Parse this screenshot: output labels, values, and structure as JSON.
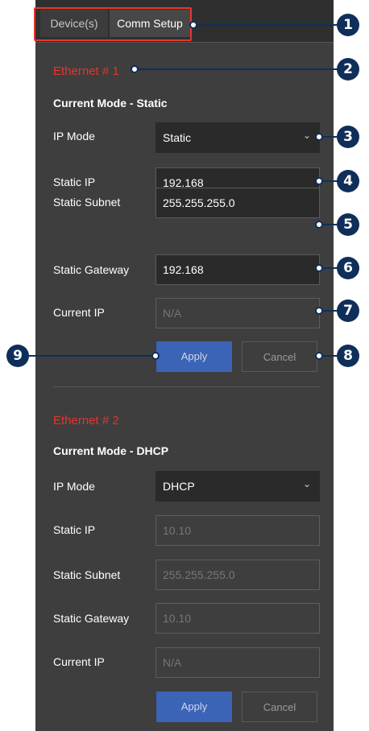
{
  "tabs": [
    {
      "label": "Device(s)"
    },
    {
      "label": "Comm Setup"
    }
  ],
  "ethernet1": {
    "title": "Ethernet # 1",
    "mode_line": "Current Mode - Static",
    "ip_mode_label": "IP Mode",
    "ip_mode_value": "Static",
    "static_ip_label": "Static IP",
    "static_ip_value": "192.168",
    "static_subnet_label": "Static Subnet",
    "static_subnet_value": "255.255.255.0",
    "static_gateway_label": "Static Gateway",
    "static_gateway_value": "192.168",
    "current_ip_label": "Current IP",
    "current_ip_placeholder": "N/A",
    "apply_label": "Apply",
    "cancel_label": "Cancel"
  },
  "ethernet2": {
    "title": "Ethernet # 2",
    "mode_line": "Current Mode - DHCP",
    "ip_mode_label": "IP Mode",
    "ip_mode_value": "DHCP",
    "static_ip_label": "Static IP",
    "static_ip_value": "10.10",
    "static_subnet_label": "Static Subnet",
    "static_subnet_value": "255.255.255.0",
    "static_gateway_label": "Static Gateway",
    "static_gateway_value": "10.10",
    "current_ip_label": "Current IP",
    "current_ip_placeholder": "N/A",
    "apply_label": "Apply",
    "cancel_label": "Cancel"
  },
  "callouts": {
    "c1": "1",
    "c2": "2",
    "c3": "3",
    "c4": "4",
    "c5": "5",
    "c6": "6",
    "c7": "7",
    "c8": "8",
    "c9": "9"
  },
  "colors": {
    "panel_bg": "#3e3e3e",
    "section_title": "#e8332a",
    "apply_button": "#3b63b6",
    "callout": "#0f2f5a",
    "tab_highlight": "#e5372e"
  },
  "icons": {
    "dropdown": "chevron-down-icon"
  }
}
